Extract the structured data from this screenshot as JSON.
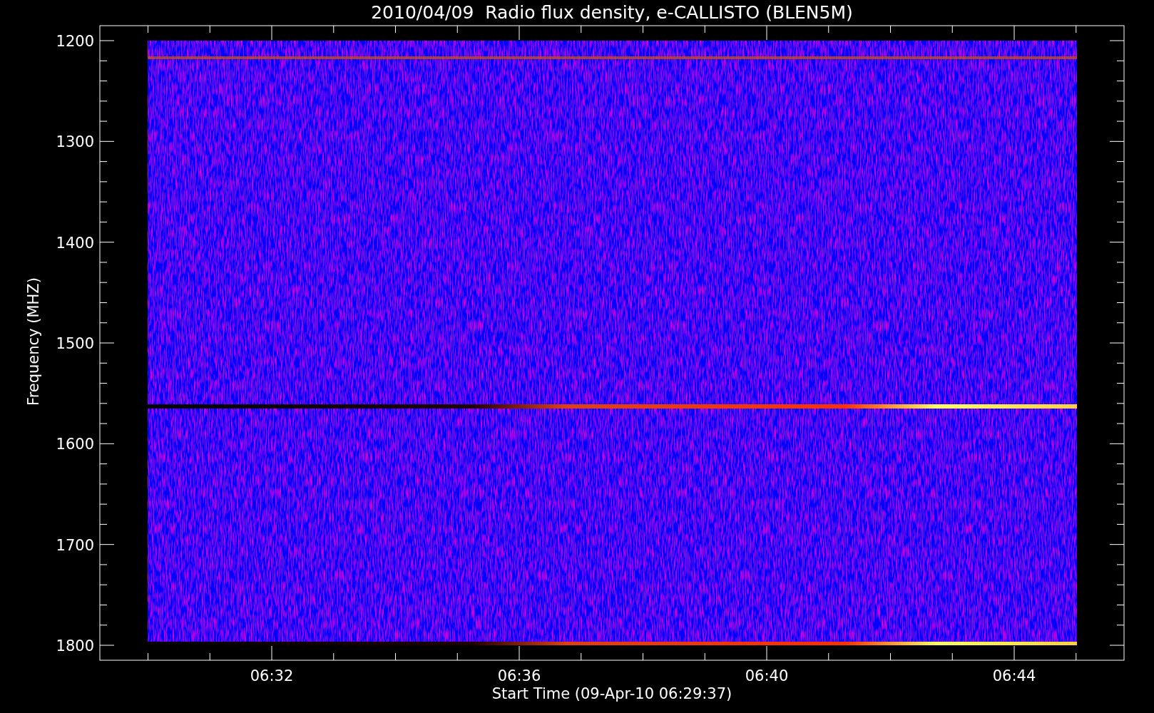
{
  "plot": {
    "title": "2010/04/09  Radio flux density, e-CALLISTO (BLEN5M)",
    "ylabel": "Frequency (MHZ)",
    "xlabel": "Start Time (09-Apr-10 06:29:37)",
    "yticks": [
      "1200",
      "1300",
      "1400",
      "1500",
      "1600",
      "1700",
      "1800"
    ],
    "xticks": [
      "06:32",
      "06:36",
      "06:40",
      "06:44"
    ]
  }
}
